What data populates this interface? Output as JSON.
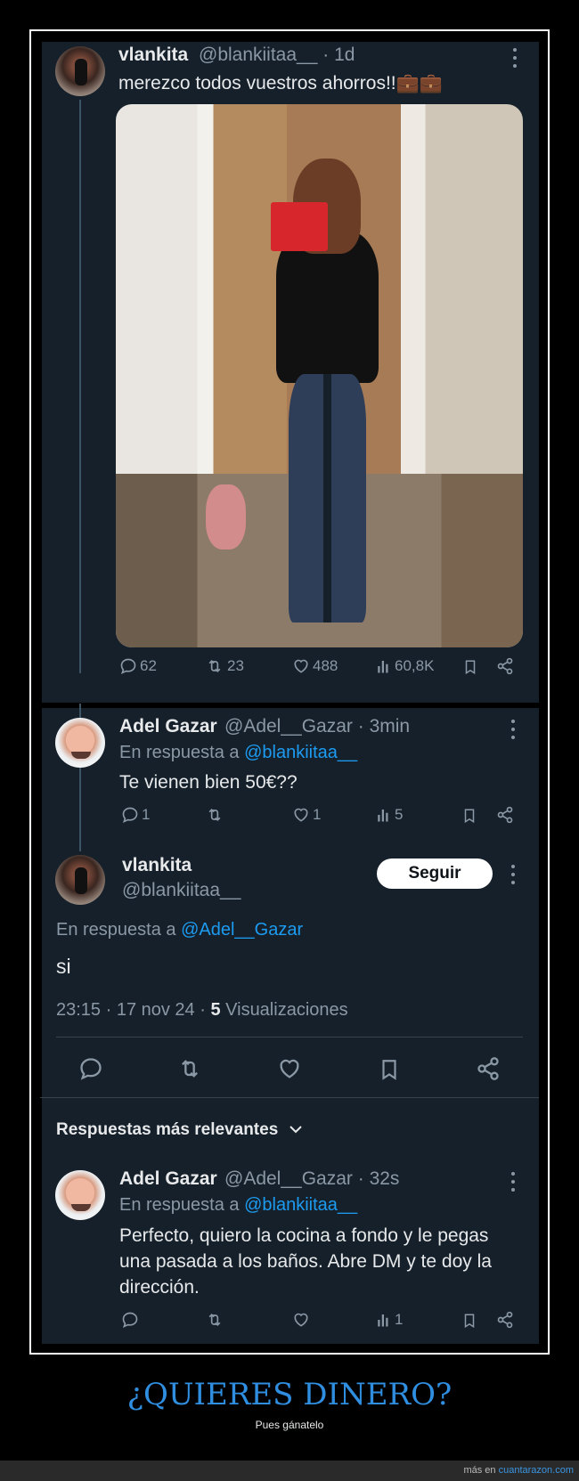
{
  "tweet1": {
    "name": "vlankita",
    "handle": "@blankiitaa__",
    "time": "· 1d",
    "text": "merezco todos vuestros ahorros!!💼💼",
    "replies": "62",
    "retweets": "23",
    "likes": "488",
    "views": "60,8K"
  },
  "reply1": {
    "name": "Adel Gazar",
    "handle": "@Adel__Gazar",
    "time": "· 3min",
    "reply_prefix": "En respuesta a",
    "reply_to": "@blankiitaa__",
    "text": "Te vienen bien 50€??",
    "replies": "1",
    "likes": "1",
    "views": "5"
  },
  "main": {
    "name": "vlankita",
    "handle": "@blankiitaa__",
    "follow_label": "Seguir",
    "reply_prefix": "En respuesta a",
    "reply_to": "@Adel__Gazar",
    "text": "si",
    "timestamp": "23:15 · 17 nov 24 ·",
    "views_count": "5",
    "views_label": "Visualizaciones"
  },
  "sort_label": "Respuestas más relevantes",
  "reply2": {
    "name": "Adel Gazar",
    "handle": "@Adel__Gazar",
    "time": "· 32s",
    "reply_prefix": "En respuesta a",
    "reply_to": "@blankiitaa__",
    "line1": "Perfecto, quiero la cocina a fondo y le pegas",
    "line2": "una pasada a los baños. Abre DM y te doy la",
    "line3": "dirección.",
    "views": "1"
  },
  "footer": {
    "title": "¿QUIERES DINERO?",
    "subtitle": "Pues gánatelo",
    "credit_prefix": "más en",
    "credit_link": "cuantarazon.com"
  },
  "icons": [
    "reply-icon",
    "retweet-icon",
    "like-icon",
    "views-icon",
    "bookmark-icon",
    "share-icon",
    "more-icon",
    "chevron-down-icon"
  ],
  "colors": {
    "background": "#15202b",
    "link": "#1d9bf0",
    "muted": "#8b98a5",
    "footer_title": "#2f8ee0"
  }
}
